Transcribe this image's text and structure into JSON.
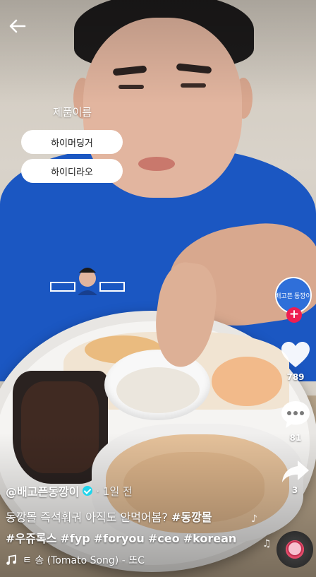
{
  "product_panel": {
    "title": "제품이름",
    "items": [
      "하이머딩거",
      "하이디라오"
    ]
  },
  "creator": {
    "avatar_label": "배고픈동깡이",
    "handle": "@배고픈동깡이",
    "time_ago": "· 1일 전"
  },
  "actions": {
    "likes": "789",
    "comments": "81",
    "shares": "3"
  },
  "caption": {
    "line1": "동깡몰 즉석훠궈 아직도 안먹어봄?",
    "hashtags_line1": [
      "#동깡몰"
    ],
    "hashtags_line2": [
      "#우쥬록스",
      "#fyp",
      "#foryou",
      "#ceo",
      "#korean"
    ]
  },
  "music": {
    "text": "ㅌ 송 (Tomato Song) - 또C"
  },
  "colors": {
    "follow_accent": "#ee1d52",
    "verified": "#20d5ec",
    "shirt": "#1b57c2"
  },
  "icons": {
    "back": "arrow-left-icon",
    "like": "heart-icon",
    "comment": "comment-bubble-icon",
    "share": "share-arrow-icon",
    "music": "music-note-icon"
  }
}
